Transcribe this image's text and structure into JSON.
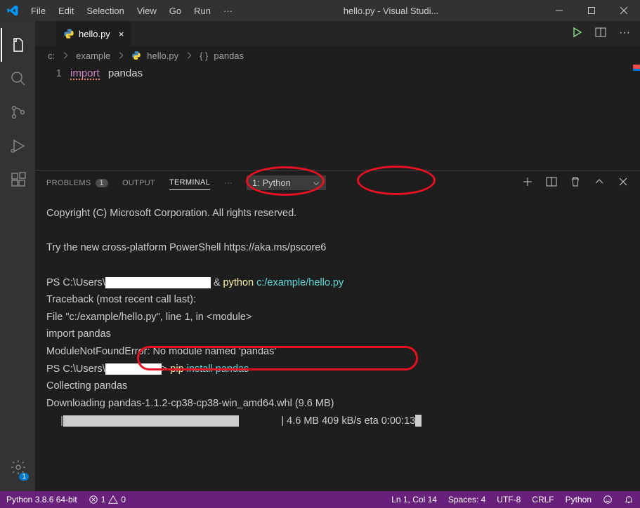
{
  "menu": {
    "items": [
      "File",
      "Edit",
      "Selection",
      "View",
      "Go",
      "Run"
    ]
  },
  "title": "hello.py - Visual Studi...",
  "tab": {
    "name": "hello.py",
    "close": "×"
  },
  "breadcrumb": {
    "drive": "c:",
    "folder": "example",
    "file": "hello.py",
    "symbol": "pandas"
  },
  "code": {
    "lineno": "1",
    "kw": "import",
    "mod": "pandas"
  },
  "panel": {
    "problems": "PROBLEMS",
    "problems_badge": "1",
    "output": "OUTPUT",
    "terminal": "TERMINAL",
    "dots": "···",
    "select": "1: Python"
  },
  "term": {
    "l1": "Copyright (C) Microsoft Corporation. All rights reserved.",
    "l2": "Try the new cross-platform PowerShell https://aka.ms/pscore6",
    "l3a": "PS C:\\Users\\",
    "l3b": "& ",
    "l3c": "python",
    "l3d": " c:/example/hello.py",
    "l4": "Traceback (most recent call last):",
    "l5": "  File \"c:/example/hello.py\", line 1, in <module>",
    "l6": "    import pandas",
    "l7": "ModuleNotFoundError: No module named 'pandas'",
    "l8a": "PS C:\\Users\\",
    "l8c": "pip",
    "l8d": " install pandas",
    "l9": "Collecting pandas",
    "l10": "  Downloading pandas-1.1.2-cp38-cp38-win_amd64.whl (9.6 MB)",
    "l11a": "| 4.6 MB 409 kB/s eta 0:00:13"
  },
  "status": {
    "python": "Python 3.8.6 64-bit",
    "err": "1",
    "warn": "0",
    "cursor": "Ln 1, Col 14",
    "spaces": "Spaces: 4",
    "enc": "UTF-8",
    "eol": "CRLF",
    "lang": "Python"
  },
  "badge": "1"
}
